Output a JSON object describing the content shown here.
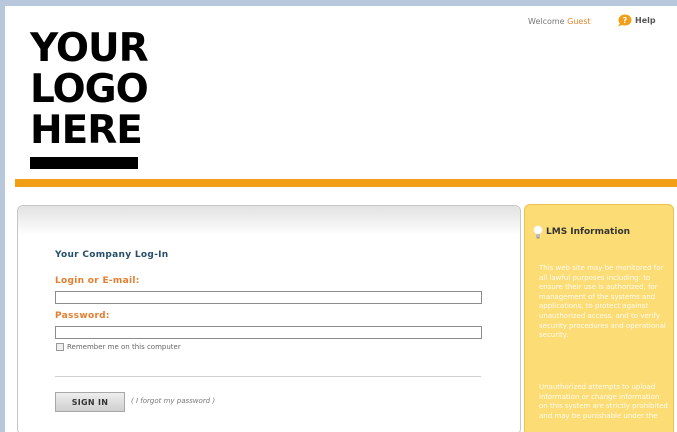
{
  "header": {
    "logo_lines": [
      "YOUR",
      "LOGO",
      "HERE"
    ],
    "welcome_label": "Welcome",
    "user_name": "Guest",
    "help_label": "Help"
  },
  "login": {
    "title": "Your Company Log-In",
    "login_label": "Login or E-mail:",
    "login_value": "",
    "password_label": "Password:",
    "password_value": "",
    "remember_label": "Remember me on this computer",
    "signin_label": "SIGN IN",
    "forgot_label": "( I forgot my password )"
  },
  "info": {
    "title": "LMS Information",
    "paragraph1": "This web site may be monitored for all lawful purposes including: to ensure their use is authorized, for management of the systems and applications, to protect against unauthorized access, and to verify security procedures and operational security.",
    "paragraph2": "Unauthorized attempts to upload information or change information on this system are strictly prohibited and may be punishable under the"
  },
  "colors": {
    "accent_orange": "#f29e17",
    "label_orange": "#e57d2e",
    "title_blue": "#244e6a",
    "info_yellow": "#fcdd75"
  },
  "icons": {
    "help": "help-bubble-icon",
    "info": "lightbulb-icon"
  }
}
